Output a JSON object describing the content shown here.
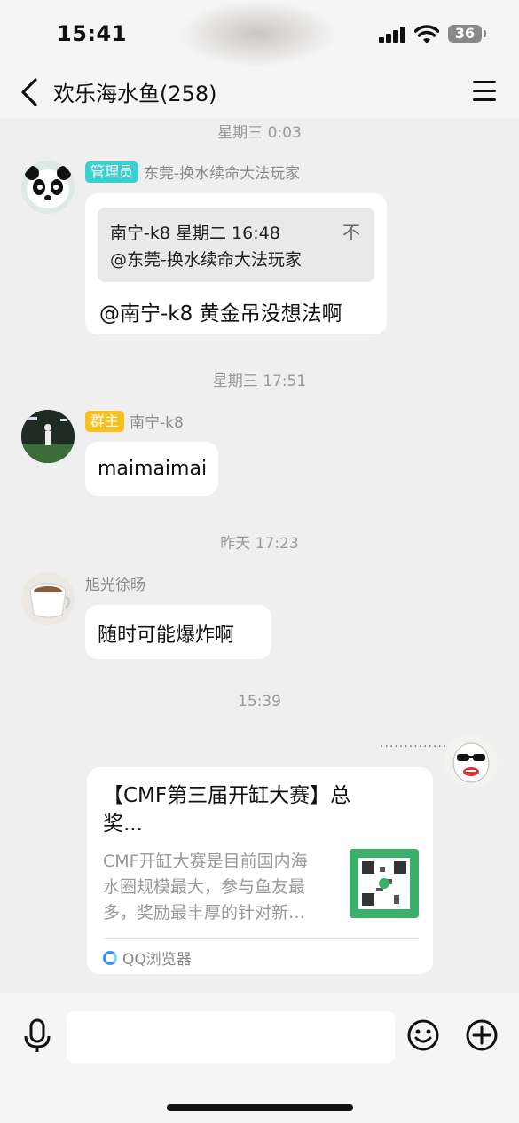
{
  "status": {
    "time": "15:41",
    "battery": "36"
  },
  "header": {
    "title": "欢乐海水鱼(258)"
  },
  "messages": {
    "ts1": "星期三 0:03",
    "m1": {
      "badge": "管理员",
      "name": "东莞-换水续命大法玩家",
      "quote_line1": "南宁-k8 星期二 16:48",
      "quote_line2": "@东莞-换水续命大法玩家",
      "quote_close": "不",
      "text": "@南宁-k8 黄金吊没想法啊"
    },
    "ts2": "星期三 17:51",
    "m2": {
      "badge": "群主",
      "name": "南宁-k8",
      "text": "maimaimai"
    },
    "ts3": "昨天 17:23",
    "m3": {
      "name": "旭光徐旸",
      "text": "随时可能爆炸啊"
    },
    "ts4": "15:39",
    "m4": {
      "dots": "··············",
      "title_line1": "【CMF第三届开缸大赛】总",
      "title_line2": "奖...",
      "desc_line1": "CMF开缸大赛是目前国内海",
      "desc_line2": "水圈规模最大，参与鱼友最",
      "desc_line3": "多，奖励最丰厚的针对新…",
      "source": "QQ浏览器"
    }
  },
  "colors": {
    "admin_badge": "#3ccfcf",
    "owner_badge": "#f6c01f",
    "qr_bg": "#3bb06a"
  },
  "icons": [
    "back-icon",
    "menu-icon",
    "mic-icon",
    "emoji-icon",
    "plus-icon",
    "qq-browser-icon"
  ]
}
